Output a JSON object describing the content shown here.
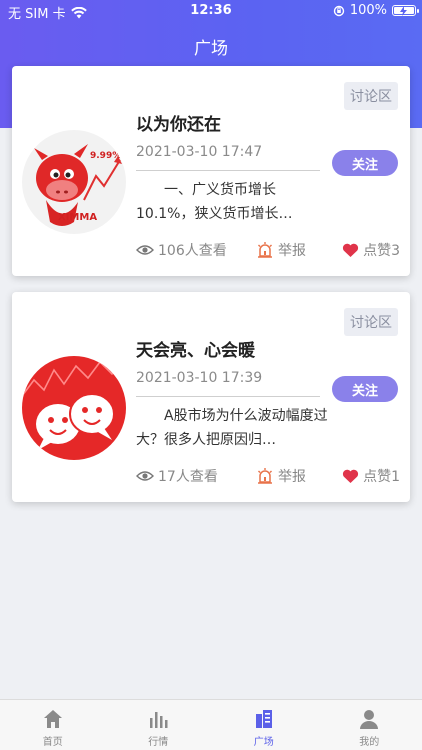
{
  "status_bar": {
    "carrier": "无 SIM 卡",
    "time": "12:36",
    "battery": "100%"
  },
  "header": {
    "title": "广场"
  },
  "posts": [
    {
      "tag": "讨论区",
      "title": "以为你还在",
      "date": "2021-03-10 17:47",
      "excerpt": "一、广义货币增长10.1%，狭义货币增长…",
      "follow_label": "关注",
      "views": "106人查看",
      "report_label": "举报",
      "likes": "点赞3",
      "avatar_text": "XIMMA",
      "avatar_badge": "9.99%"
    },
    {
      "tag": "讨论区",
      "title": "天会亮、心会暖",
      "date": "2021-03-10 17:39",
      "excerpt": "A股市场为什么波动幅度过大？很多人把原因归…",
      "follow_label": "关注",
      "views": "17人查看",
      "report_label": "举报",
      "likes": "点赞1"
    }
  ],
  "tabbar": {
    "items": [
      {
        "label": "首页",
        "icon": "home-icon"
      },
      {
        "label": "行情",
        "icon": "bar-chart-icon"
      },
      {
        "label": "广场",
        "icon": "square-icon",
        "active": true
      },
      {
        "label": "我的",
        "icon": "user-icon"
      }
    ]
  },
  "colors": {
    "accent": "#5b60e8",
    "follow_button": "#8a81ea",
    "header_gradient_start": "#6a5cf0",
    "like_heart": "#e0344a",
    "report_icon": "#e8734a"
  }
}
